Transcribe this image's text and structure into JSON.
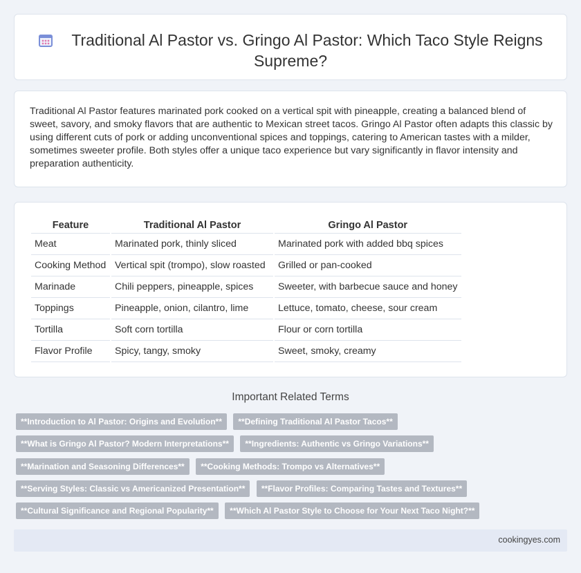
{
  "header": {
    "title": "Traditional Al Pastor vs. Gringo Al Pastor: Which Taco Style Reigns Supreme?",
    "icon": "calendar-icon"
  },
  "intro": {
    "text": "Traditional Al Pastor features marinated pork cooked on a vertical spit with pineapple, creating a balanced blend of sweet, savory, and smoky flavors that are authentic to Mexican street tacos. Gringo Al Pastor often adapts this classic by using different cuts of pork or adding unconventional spices and toppings, catering to American tastes with a milder, sometimes sweeter profile. Both styles offer a unique taco experience but vary significantly in flavor intensity and preparation authenticity."
  },
  "comparison": {
    "headers": [
      "Feature",
      "Traditional Al Pastor",
      "Gringo Al Pastor"
    ],
    "rows": [
      [
        "Meat",
        "Marinated pork, thinly sliced",
        "Marinated pork with added bbq spices"
      ],
      [
        "Cooking Method",
        "Vertical spit (trompo), slow roasted",
        "Grilled or pan-cooked"
      ],
      [
        "Marinade",
        "Chili peppers, pineapple, spices",
        "Sweeter, with barbecue sauce and honey"
      ],
      [
        "Toppings",
        "Pineapple, onion, cilantro, lime",
        "Lettuce, tomato, cheese, sour cream"
      ],
      [
        "Tortilla",
        "Soft corn tortilla",
        "Flour or corn tortilla"
      ],
      [
        "Flavor Profile",
        "Spicy, tangy, smoky",
        "Sweet, smoky, creamy"
      ]
    ]
  },
  "related": {
    "heading": "Important Related Terms",
    "tags": [
      [
        "**Introduction to Al Pastor: Origins and Evolution**",
        "**Defining Traditional Al Pastor Tacos**"
      ],
      [
        "**What is Gringo Al Pastor? Modern Interpretations**",
        "**Ingredients: Authentic vs Gringo Variations**"
      ],
      [
        "**Marination and Seasoning Differences**",
        "**Cooking Methods: Trompo vs Alternatives**"
      ],
      [
        "**Serving Styles: Classic vs Americanized Presentation**",
        "**Flavor Profiles: Comparing Tastes and Textures**"
      ],
      [
        "**Cultural Significance and Regional Popularity**",
        "**Which Al Pastor Style to Choose for Your Next Taco Night?**"
      ]
    ]
  },
  "footer": {
    "site": "cookingyes.com"
  },
  "colors": {
    "page_bg": "#f0f3f8",
    "tag_bg": "#b3b8c1",
    "footer_bg": "#e4e9f4"
  }
}
